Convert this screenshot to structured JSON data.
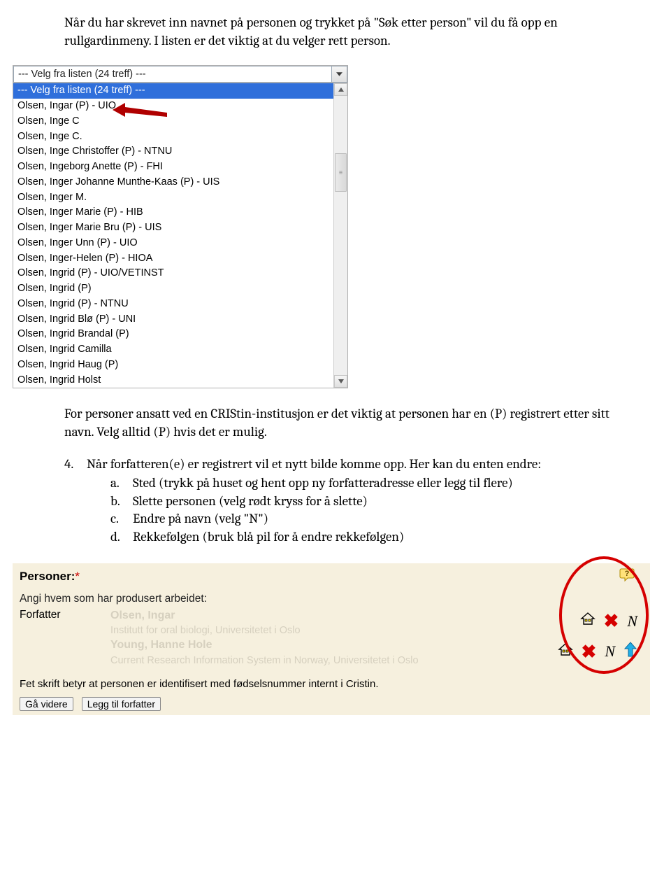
{
  "para1": "Når du har skrevet inn navnet på personen og trykket på \"Søk etter person\" vil du få opp en rullgardinmeny. I listen er det viktig at du velger rett person.",
  "dropdown": {
    "selected_text": "--- Velg fra listen (24 treff) ---",
    "highlighted": "--- Velg fra listen (24 treff) ---",
    "items": [
      "Olsen, Ingar (P) - UIO",
      "Olsen, Inge C",
      "Olsen, Inge C.",
      "Olsen, Inge Christoffer (P) - NTNU",
      "Olsen, Ingeborg Anette (P) - FHI",
      "Olsen, Inger Johanne Munthe-Kaas (P) - UIS",
      "Olsen, Inger M.",
      "Olsen, Inger Marie (P) - HIB",
      "Olsen, Inger Marie Bru (P) - UIS",
      "Olsen, Inger Unn (P) - UIO",
      "Olsen, Inger-Helen (P) - HIOA",
      "Olsen, Ingrid (P) - UIO/VETINST",
      "Olsen, Ingrid (P)",
      "Olsen, Ingrid (P) - NTNU",
      "Olsen, Ingrid Blø (P) - UNI",
      "Olsen, Ingrid Brandal (P)",
      "Olsen, Ingrid Camilla",
      "Olsen, Ingrid Haug (P)",
      "Olsen, Ingrid Holst"
    ]
  },
  "para2": "For personer ansatt ved en CRIStin-institusjon er det viktig at personen har en (P) registrert etter sitt navn. Velg alltid (P) hvis det er mulig.",
  "numlist": {
    "marker": "4.",
    "lead": "Når forfatteren(e) er registrert vil et nytt bilde komme opp. Her kan du enten endre:",
    "subs": [
      {
        "m": "a.",
        "t": "Sted (trykk på huset og hent opp ny forfatteradresse eller legg til flere)"
      },
      {
        "m": "b.",
        "t": "Slette personen (velg rødt kryss for å slette)"
      },
      {
        "m": "c.",
        "t": "Endre på navn (velg \"N\")"
      },
      {
        "m": "d.",
        "t": "Rekkefølgen (bruk blå pil for å endre rekkefølgen)"
      }
    ]
  },
  "persons": {
    "title": "Personer:",
    "asterisk": "*",
    "sub": "Angi hvem som har produsert arbeidet:",
    "role": "Forfatter",
    "faded_rows": [
      {
        "name": "Olsen, Ingar",
        "aff": "Institutt for oral biologi, Universitetet i Oslo"
      },
      {
        "name": "Young, Hanne Hole",
        "aff": "Current Research Information System in Norway, Universitetet i Oslo"
      }
    ],
    "icon_labels": {
      "house": "house-icon",
      "x": "delete-x-icon",
      "n": "edit-name-n-icon",
      "up": "reorder-up-arrow-icon"
    },
    "note": "Fet skrift betyr at personen er identifisert med fødselsnummer internt i Cristin.",
    "btn_next": "Gå videre",
    "btn_add": "Legg til forfatter"
  }
}
